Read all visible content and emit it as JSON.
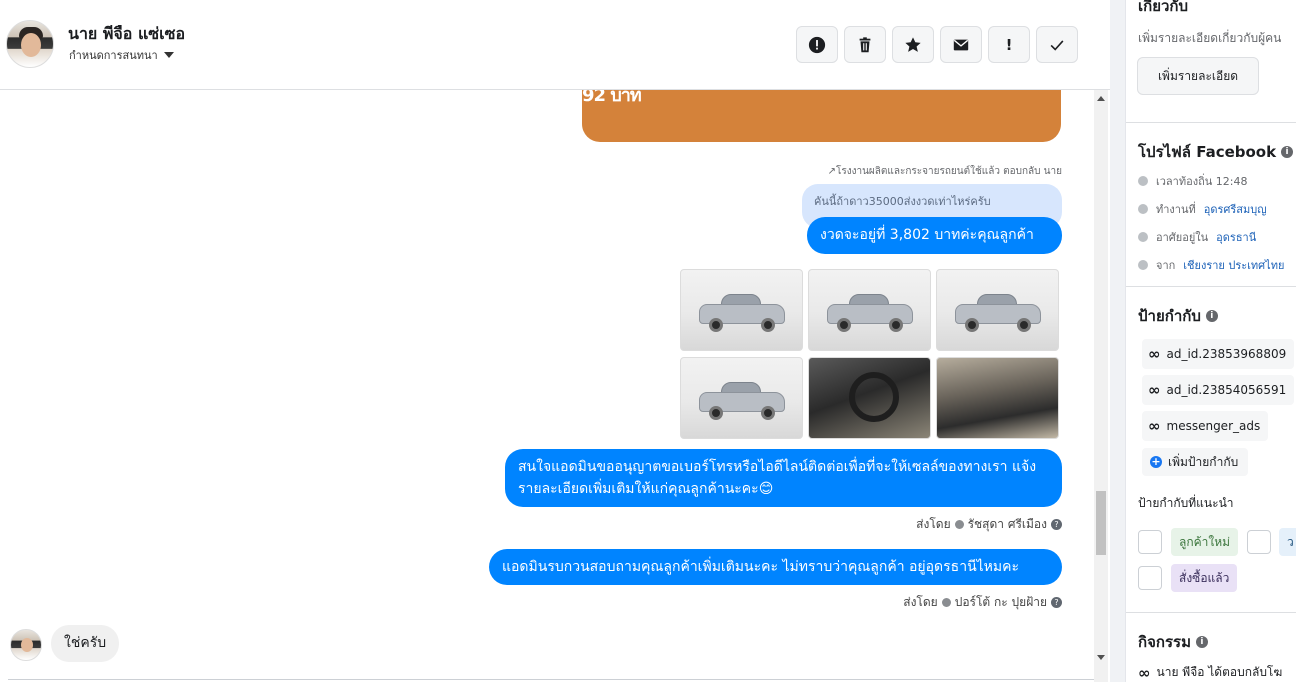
{
  "header": {
    "contact_name": "นาย พีจือ แซ่เซอ",
    "assign_label": "กำหนดการสนทนา",
    "toolbar": [
      {
        "icon": "spam-icon"
      },
      {
        "icon": "trash-icon"
      },
      {
        "icon": "star-icon"
      },
      {
        "icon": "mail-icon"
      },
      {
        "icon": "exclamation-icon",
        "label": "!"
      },
      {
        "icon": "check-icon"
      }
    ]
  },
  "conversation": {
    "card_text": "92 บาท",
    "reply_meta": "โรงงานผลิตและกระจายรถยนต์ใช้แล้ว ตอบกลับ นาย",
    "quoted_text": "คันนี้ถ้าดาว35000ส่งงวดเท่าไหร่ครับ",
    "messages": [
      {
        "text": "งวดจะอยู่ที่ 3,802  บาทค่ะคุณลูกค้า"
      },
      {
        "text": "สนใจแอดมินขออนุญาตขอเบอร์โทรหรือไอดีไลน์ติดต่อเพื่อที่จะให้เซลล์ของทางเรา แจ้งรายละเอียดเพิ่มเติมให้แก่คุณลูกค้านะคะ😊",
        "sent_by_label": "ส่งโดย",
        "sender": "รัชสุดา ศรีเมือง"
      },
      {
        "text": "แอดมินรบกวนสอบถามคุณลูกค้าเพิ่มเติมนะคะ ไม่ทราบว่าคุณลูกค้า อยู่อุดรธานีไหมคะ",
        "sent_by_label": "ส่งโดย",
        "sender": "ปอร์โต้ กะ ปุยฝ้าย"
      }
    ],
    "photos": [
      "car-front-photo",
      "car-front-angle-photo",
      "car-rear-photo",
      "car-side-photo",
      "steering-wheel-photo",
      "gear-shift-photo"
    ],
    "incoming_reply": "ใช่ครับ"
  },
  "sidebar": {
    "about": {
      "title": "เกี่ยวกับ",
      "description": "เพิ่มรายละเอียดเกี่ยวกับผู้คน",
      "add_button": "เพิ่มรายละเอียด"
    },
    "profile": {
      "title": "โปรไฟล์ Facebook",
      "rows": [
        {
          "icon": "clock-icon",
          "label": "เวลาท้องถิ่น 12:48",
          "link": ""
        },
        {
          "icon": "briefcase-icon",
          "label": "ทำงานที่",
          "link": "อุดรศรีสมบุญ"
        },
        {
          "icon": "location-icon",
          "label": "อาศัยอยู่ใน",
          "link": "อุดรธานี"
        },
        {
          "icon": "location-icon",
          "label": "จาก",
          "link": "เชียงราย ประเทศไทย"
        }
      ]
    },
    "labels": {
      "title": "ป้ายกำกับ",
      "tags": [
        "ad_id.23853968809",
        "ad_id.23854056591",
        "messenger_ads"
      ],
      "add_label": "เพิ่มป้ายกำกับ",
      "suggested_title": "ป้ายกำกับที่แนะนำ",
      "suggested": [
        "ลูกค้าใหม่",
        "ว",
        "สั่งซื้อแล้ว"
      ]
    },
    "activity": {
      "title": "กิจกรรม",
      "first_item": "นาย พีจือ ได้ตอบกลับโฆ"
    }
  }
}
